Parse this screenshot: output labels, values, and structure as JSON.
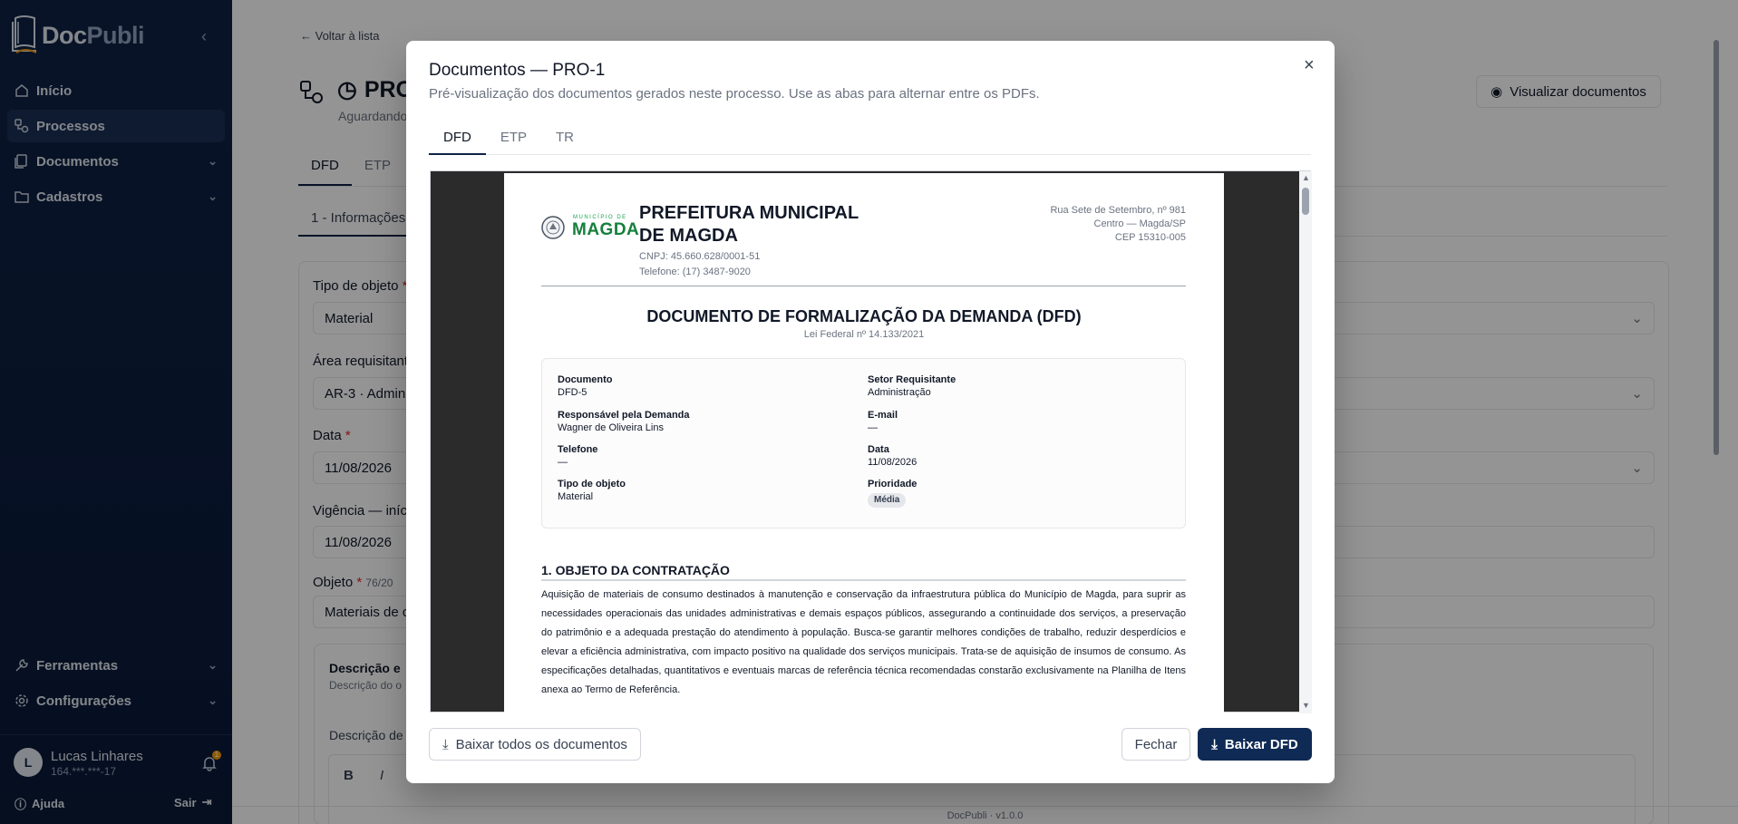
{
  "brand": {
    "part1": "Doc",
    "part2": "Publi"
  },
  "sidebar": {
    "items": [
      {
        "label": "Início"
      },
      {
        "label": "Processos"
      },
      {
        "label": "Documentos"
      },
      {
        "label": "Cadastros"
      }
    ],
    "bottom_items": [
      {
        "label": "Ferramentas"
      },
      {
        "label": "Configurações"
      }
    ],
    "user": {
      "initial": "L",
      "name": "Lucas Linhares",
      "cpf": "164.***.***-17",
      "notifications": "1"
    },
    "help_label": "Ajuda",
    "logout_label": "Sair"
  },
  "main": {
    "back_label": "← Voltar à lista",
    "title": "PRO",
    "subtitle": "Aguardando",
    "view_docs_label": "Visualizar documentos",
    "tabs": [
      "DFD",
      "ETP"
    ],
    "section_tab": "1 - Informações",
    "fields": {
      "tipo_label": "Tipo de objeto",
      "tipo_value": "Material",
      "area_label": "Área requisitant",
      "area_value": "AR-3 · Admin",
      "data_label": "Data",
      "data_value": "11/08/2026",
      "vig_label": "Vigência — iníc",
      "vig_value": "11/08/2026",
      "obj_label": "Objeto",
      "obj_count": "76/20",
      "obj_value": "Materiais de c"
    },
    "desc_title": "Descrição e",
    "desc_sub": "Descrição do o",
    "desc_label": "Descrição de",
    "footer": "DocPubli · v1.0.0"
  },
  "modal": {
    "title": "Documentos — PRO-1",
    "description": "Pré-visualização dos documentos gerados neste processo. Use as abas para alternar entre os PDFs.",
    "tabs": [
      "DFD",
      "ETP",
      "TR"
    ],
    "download_all_label": "Baixar todos os documentos",
    "close_label": "Fechar",
    "download_label": "Baixar DFD"
  },
  "doc": {
    "municipio_label": "MUNICÍPIO DE",
    "logo_text": "MAGDA",
    "org_name": "PREFEITURA MUNICIPAL DE MAGDA",
    "cnpj": "CNPJ: 45.660.628/0001-51",
    "telefone": "Telefone: (17) 3487-9020",
    "address1": "Rua Sete de Setembro, nº 981",
    "address2": "Centro — Magda/SP",
    "address3": "CEP 15310-005",
    "doc_title": "DOCUMENTO DE FORMALIZAÇÃO DA DEMANDA (DFD)",
    "lei": "Lei Federal nº 14.133/2021",
    "fields": {
      "documento_k": "Documento",
      "documento_v": "DFD-5",
      "setor_k": "Setor Requisitante",
      "setor_v": "Administração",
      "resp_k": "Responsável pela Demanda",
      "resp_v": "Wagner de Oliveira Lins",
      "email_k": "E-mail",
      "email_v": "—",
      "tel_k": "Telefone",
      "tel_v": "—",
      "data_k": "Data",
      "data_v": "11/08/2026",
      "tipo_k": "Tipo de objeto",
      "tipo_v": "Material",
      "prio_k": "Prioridade",
      "prio_v": "Média"
    },
    "section1_title": "1. OBJETO DA CONTRATAÇÃO",
    "section1_body": "Aquisição de materiais de consumo destinados à manutenção e conservação da infraestrutura pública do Município de Magda, para suprir as necessidades operacionais das unidades administrativas e demais espaços públicos, assegurando a continuidade dos serviços, a preservação do patrimônio e a adequada prestação do atendimento à população. Busca-se garantir melhores condições de trabalho, reduzir desperdícios e elevar a eficiência administrativa, com impacto positivo na qualidade dos serviços municipais. Trata-se de aquisição de insumos de consumo. As especificações detalhadas, quantitativos e eventuais marcas de referência técnica recomendadas constarão exclusivamente na Planilha de Itens anexa ao Termo de Referência."
  },
  "colors": {
    "sidebar": "#0f2246",
    "primary": "#0f2a55",
    "logo_green": "#15803d",
    "badge": "#e5e7eb"
  }
}
